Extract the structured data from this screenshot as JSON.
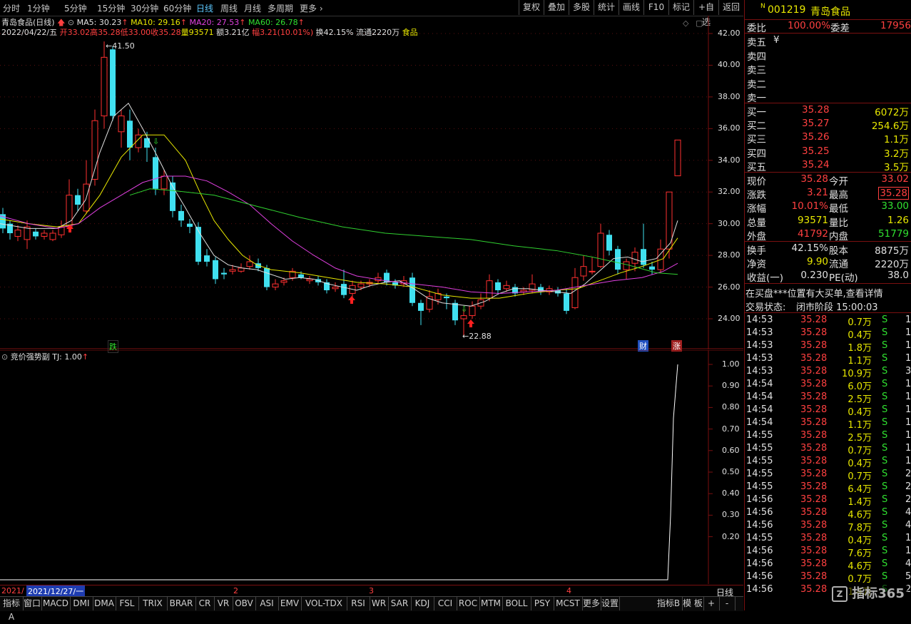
{
  "toolbar": {
    "periods": [
      "分时",
      "1分钟",
      "5分钟",
      "15分钟",
      "30分钟",
      "60分钟",
      "日线",
      "周线",
      "月线",
      "多周期",
      "更多"
    ],
    "active_period": "日线",
    "buttons": [
      "复权",
      "叠加",
      "多股",
      "统计",
      "画线",
      "F10",
      "标记",
      "+自选",
      "返回"
    ]
  },
  "main": {
    "title": "青岛食品(日线)",
    "ma_labels": {
      "ma5": "MA5: 30.23",
      "ma10": "MA10: 29.16",
      "ma20": "MA20: 27.53",
      "ma60": "MA60: 26.78"
    },
    "bar_date": "2022/04/22/五",
    "bar_open": "开33.02",
    "bar_high": "高35.28",
    "bar_low": "低33.00",
    "bar_close": "收35.28",
    "bar_volume": "量93571",
    "bar_amount": "额3.21亿",
    "bar_change": "幅3.21(10.01%)",
    "bar_turnover": "换42.15%",
    "bar_float": "流通2220万",
    "bar_sector": "食品",
    "high_mark": "41.50",
    "low_mark": "22.88",
    "marker_die": "跌",
    "marker_cai": "财",
    "marker_zhang": "涨",
    "y_ticks": [
      "42.00",
      "40.00",
      "38.00",
      "36.00",
      "34.00",
      "32.00",
      "30.00",
      "28.00",
      "26.00",
      "24.00"
    ]
  },
  "sub": {
    "title": "竞价强势副",
    "tj_label": "TJ: 1.00",
    "y_ticks": [
      "1.00",
      "0.90",
      "0.80",
      "0.70",
      "0.60",
      "0.50",
      "0.40",
      "0.30",
      "0.20"
    ]
  },
  "time_axis": {
    "start": "2021/",
    "cursor_date": "2021/12/27/一",
    "month_labels": [
      "2",
      "3",
      "4"
    ],
    "right_label": "日线"
  },
  "tabs": [
    "指标A",
    "窗口",
    "MACD",
    "DMI",
    "DMA",
    "FSL",
    "TRIX",
    "BRAR",
    "CR",
    "VR",
    "OBV",
    "ASI",
    "EMV",
    "VOL-TDX",
    "RSI",
    "WR",
    "SAR",
    "KDJ",
    "CCI",
    "ROC",
    "MTM",
    "BOLL",
    "PSY",
    "MCST",
    "更多",
    "设置"
  ],
  "tabs_right": [
    "指标B",
    "模 板",
    "+",
    "-"
  ],
  "panel": {
    "code": "001219",
    "name": "青岛食品",
    "weibi_label": "委比",
    "weibi_value": "100.00%",
    "weicha_label": "委差",
    "weicha_value": "17956",
    "sell_labels": [
      "卖五",
      "卖四",
      "卖三",
      "卖二",
      "卖一"
    ],
    "sell_currency": "¥",
    "buys": [
      {
        "label": "买一",
        "price": "35.28",
        "vol": "6072万"
      },
      {
        "label": "买二",
        "price": "35.27",
        "vol": "254.6万"
      },
      {
        "label": "买三",
        "price": "35.26",
        "vol": "1.1万"
      },
      {
        "label": "买四",
        "price": "35.25",
        "vol": "3.2万"
      },
      {
        "label": "买五",
        "price": "35.24",
        "vol": "3.5万"
      }
    ],
    "stats": [
      {
        "l1": "现价",
        "v1": "35.28",
        "l2": "今开",
        "v2": "33.02"
      },
      {
        "l1": "涨跌",
        "v1": "3.21",
        "l2": "最高",
        "v2": "35.28"
      },
      {
        "l1": "涨幅",
        "v1": "10.01%",
        "l2": "最低",
        "v2": "33.00"
      },
      {
        "l1": "总量",
        "v1": "93571",
        "l2": "量比",
        "v2": "1.26"
      },
      {
        "l1": "外盘",
        "v1": "41792",
        "l2": "内盘",
        "v2": "51779"
      }
    ],
    "stats2": [
      {
        "l1": "换手",
        "v1": "42.15%",
        "l2": "股本",
        "v2": "8875万"
      },
      {
        "l1": "净资",
        "v1": "9.90",
        "l2": "流通",
        "v2": "2220万"
      },
      {
        "l1": "收益(一)",
        "v1": "0.230",
        "l2": "PE(动)",
        "v2": "38.0"
      }
    ],
    "notice": "在买盘***位置有大买单,查看详情",
    "status_label": "交易状态:",
    "status_value": "闭市阶段 15:00:03",
    "ticks": [
      {
        "t": "14:53",
        "p": "35.28",
        "v": "0.7万",
        "s": "S",
        "n": "1"
      },
      {
        "t": "14:53",
        "p": "35.28",
        "v": "0.4万",
        "s": "S",
        "n": "1"
      },
      {
        "t": "14:53",
        "p": "35.28",
        "v": "1.8万",
        "s": "S",
        "n": "1"
      },
      {
        "t": "14:53",
        "p": "35.28",
        "v": "1.1万",
        "s": "S",
        "n": "1"
      },
      {
        "t": "14:53",
        "p": "35.28",
        "v": "10.9万",
        "s": "S",
        "n": "3"
      },
      {
        "t": "14:54",
        "p": "35.28",
        "v": "6.0万",
        "s": "S",
        "n": "1"
      },
      {
        "t": "14:54",
        "p": "35.28",
        "v": "2.5万",
        "s": "S",
        "n": "1"
      },
      {
        "t": "14:54",
        "p": "35.28",
        "v": "0.4万",
        "s": "S",
        "n": "1"
      },
      {
        "t": "14:54",
        "p": "35.28",
        "v": "1.1万",
        "s": "S",
        "n": "1"
      },
      {
        "t": "14:55",
        "p": "35.28",
        "v": "2.5万",
        "s": "S",
        "n": "1"
      },
      {
        "t": "14:55",
        "p": "35.28",
        "v": "0.7万",
        "s": "S",
        "n": "1"
      },
      {
        "t": "14:55",
        "p": "35.28",
        "v": "0.4万",
        "s": "S",
        "n": "1"
      },
      {
        "t": "14:55",
        "p": "35.28",
        "v": "0.7万",
        "s": "S",
        "n": "2"
      },
      {
        "t": "14:55",
        "p": "35.28",
        "v": "6.4万",
        "s": "S",
        "n": "2"
      },
      {
        "t": "14:56",
        "p": "35.28",
        "v": "1.4万",
        "s": "S",
        "n": "2"
      },
      {
        "t": "14:56",
        "p": "35.28",
        "v": "4.6万",
        "s": "S",
        "n": "4"
      },
      {
        "t": "14:56",
        "p": "35.28",
        "v": "7.8万",
        "s": "S",
        "n": "4"
      },
      {
        "t": "14:55",
        "p": "35.28",
        "v": "0.4万",
        "s": "S",
        "n": "1"
      },
      {
        "t": "14:56",
        "p": "35.28",
        "v": "7.6万",
        "s": "S",
        "n": "1"
      },
      {
        "t": "14:56",
        "p": "35.28",
        "v": "4.6万",
        "s": "S",
        "n": "4"
      },
      {
        "t": "14:56",
        "p": "35.28",
        "v": "0.7万",
        "s": "S",
        "n": "5"
      },
      {
        "t": "14:56",
        "p": "35.28",
        "v": "1.4万",
        "s": "S",
        "n": "2"
      }
    ],
    "watermark": "指标365"
  },
  "colors": {
    "up": "#ff3030",
    "down": "#40e0f0",
    "ma5": "#e0e0e0",
    "ma10": "#e8e800",
    "ma20": "#e040e0",
    "ma60": "#30d030",
    "axis": "#7a1010"
  }
}
